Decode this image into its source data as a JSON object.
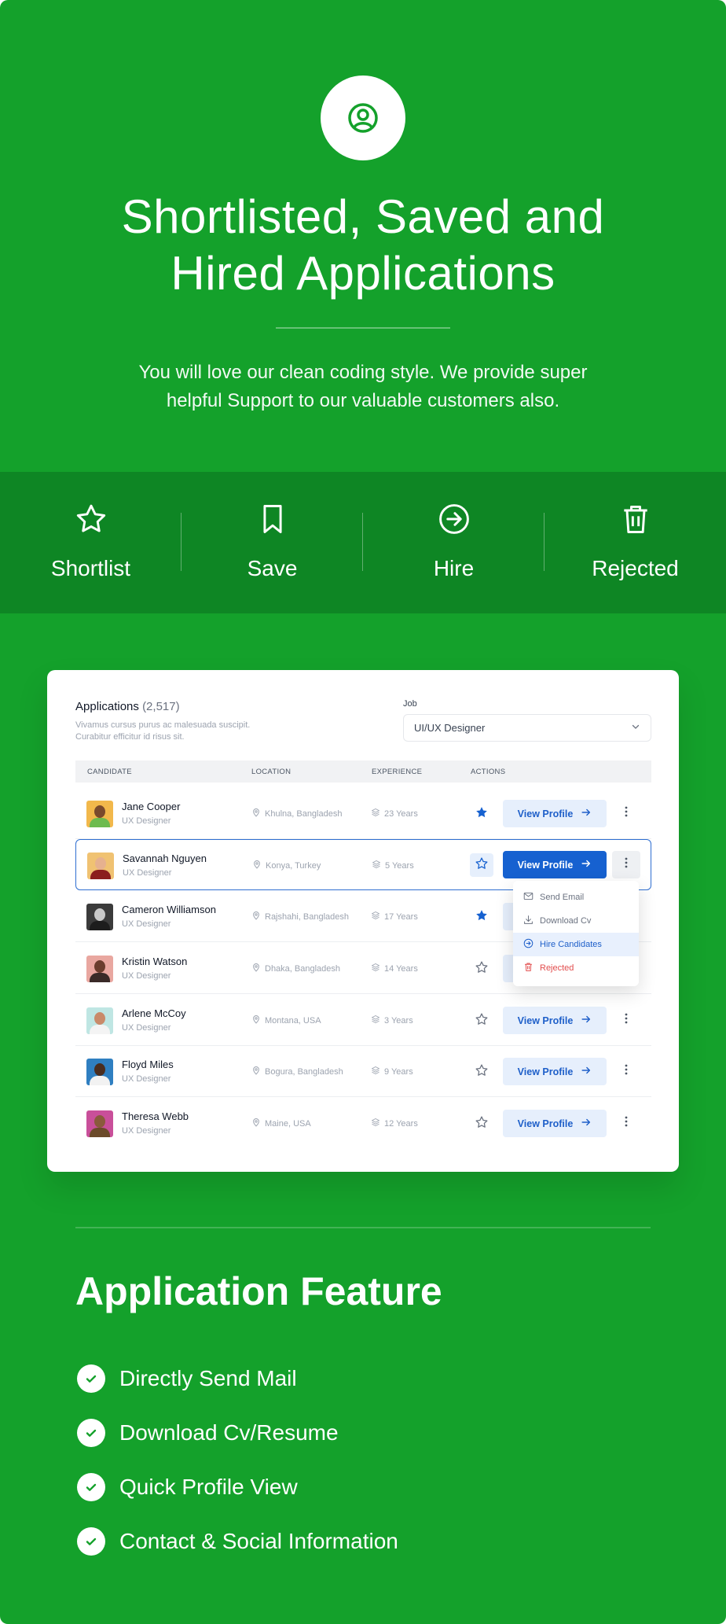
{
  "hero": {
    "title_line1": "Shortlisted, Saved and",
    "title_line2": "Hired Applications",
    "subtitle_line1": "You will love our clean coding style. We provide super",
    "subtitle_line2": "helpful Support to our valuable customers also.",
    "icon": "user-circle-icon"
  },
  "strip": {
    "items": [
      {
        "label": "Shortlist",
        "icon": "star-icon"
      },
      {
        "label": "Save",
        "icon": "bookmark-icon"
      },
      {
        "label": "Hire",
        "icon": "arrow-circle-icon"
      },
      {
        "label": "Rejected",
        "icon": "trash-icon"
      }
    ]
  },
  "card": {
    "title": "Applications",
    "count": "(2,517)",
    "desc_line1": "Vivamus cursus purus ac malesuada suscipit.",
    "desc_line2": "Curabitur efficitur id risus sit.",
    "job_label": "Job",
    "job_value": "UI/UX Designer",
    "columns": [
      "CANDIDATE",
      "LOCATION",
      "EXPERIENCE",
      "ACTIONS"
    ],
    "view_label": "View Profile",
    "rows": [
      {
        "name": "Jane Cooper",
        "role": "UX Designer",
        "location": "Khulna, Bangladesh",
        "experience": "23 Years",
        "starred": true
      },
      {
        "name": "Savannah Nguyen",
        "role": "UX Designer",
        "location": "Konya, Turkey",
        "experience": "5 Years",
        "starred": false
      },
      {
        "name": "Cameron Williamson",
        "role": "UX Designer",
        "location": "Rajshahi, Bangladesh",
        "experience": "17 Years",
        "starred": true
      },
      {
        "name": "Kristin Watson",
        "role": "UX Designer",
        "location": "Dhaka, Bangladesh",
        "experience": "14 Years",
        "starred": false
      },
      {
        "name": "Arlene McCoy",
        "role": "UX Designer",
        "location": "Montana, USA",
        "experience": "3 Years",
        "starred": false
      },
      {
        "name": "Floyd Miles",
        "role": "UX Designer",
        "location": "Bogura, Bangladesh",
        "experience": "9 Years",
        "starred": false
      },
      {
        "name": "Theresa Webb",
        "role": "UX Designer",
        "location": "Maine, USA",
        "experience": "12 Years",
        "starred": false
      }
    ],
    "dropdown": {
      "items": [
        {
          "label": "Send Email",
          "icon": "mail-icon"
        },
        {
          "label": "Download Cv",
          "icon": "download-icon"
        },
        {
          "label": "Hire Candidates",
          "icon": "arrow-circle-icon"
        },
        {
          "label": "Rejected",
          "icon": "trash-icon"
        }
      ]
    }
  },
  "features": {
    "title": "Application Feature",
    "items": [
      "Directly Send Mail",
      "Download Cv/Resume",
      "Quick Profile View",
      "Contact & Social Information"
    ]
  },
  "colors": {
    "background": "#14a12b",
    "strip": "#0e8624",
    "primary_blue": "#1661d0",
    "light_blue": "#e6effc",
    "danger": "#e24d4d"
  }
}
